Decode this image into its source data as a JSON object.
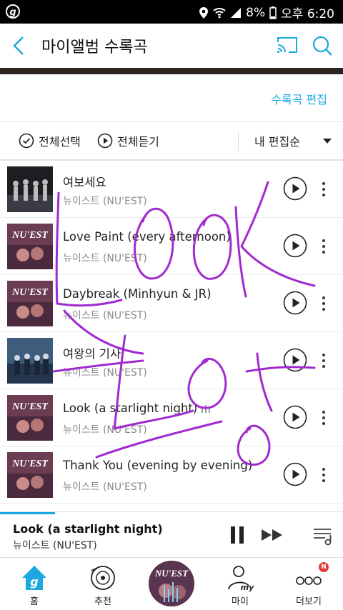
{
  "status_bar": {
    "battery": "8%",
    "time": "오후 6:20",
    "logo": "g"
  },
  "header": {
    "title": "마이앨범 수록곡"
  },
  "edit_link": "수록곡 편집",
  "toolbar": {
    "select_all": "전체선택",
    "play_all": "전체듣기",
    "sort": "내 편집순"
  },
  "songs": [
    {
      "title": "여보세요",
      "artist": "뉴이스트 (NU'EST)",
      "playing": false
    },
    {
      "title": "Love Paint (every afternoon)",
      "artist": "뉴이스트 (NU'EST)",
      "playing": false
    },
    {
      "title": "Daybreak (Minhyun & JR)",
      "artist": "뉴이스트 (NU'EST)",
      "playing": false
    },
    {
      "title": "여왕의 기사",
      "artist": "뉴이스트 (NU'EST)",
      "playing": false
    },
    {
      "title": "Look (a starlight night)",
      "artist": "뉴이스트 (NU'EST)",
      "playing": true
    },
    {
      "title": "Thank You (evening by evening)",
      "artist": "뉴이스트 (NU'EST)",
      "playing": false
    }
  ],
  "album_art_text": "NU'EST",
  "mini_player": {
    "title": "Look (a starlight night)",
    "artist": "뉴이스트 (NU'EST)",
    "progress": 0.16
  },
  "bottom_nav": {
    "home": "홈",
    "recommend": "추천",
    "my": "마이",
    "more": "더보기",
    "my_icon_text": "my",
    "badge": "N",
    "home_icon_text": "g"
  },
  "colors": {
    "accent": "#1da7e0",
    "badge": "#e53935",
    "annotation": "#a12bd0"
  }
}
